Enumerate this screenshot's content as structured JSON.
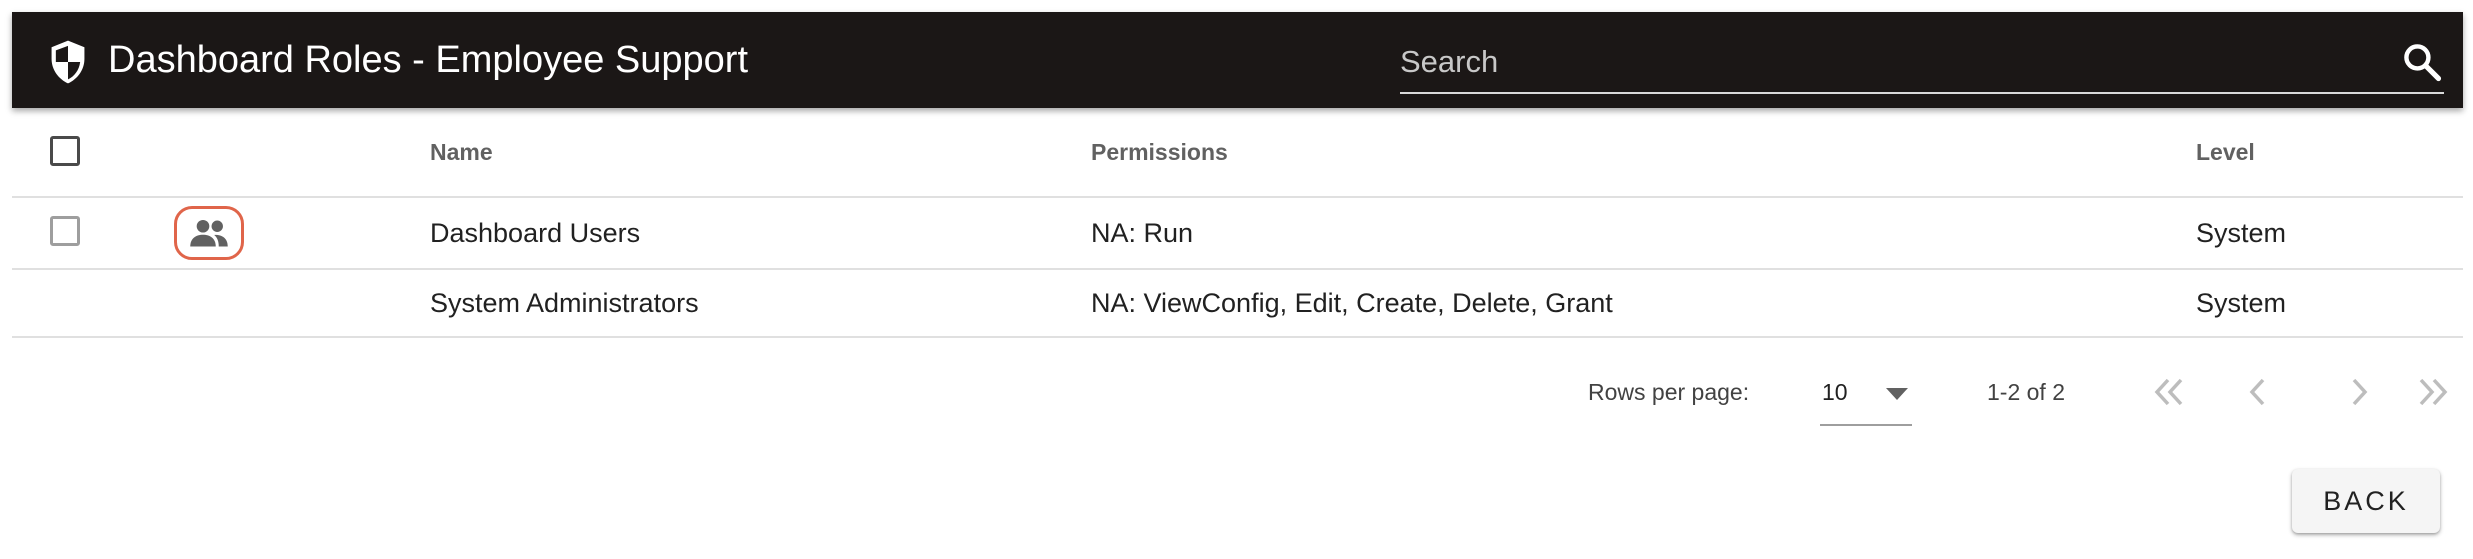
{
  "header": {
    "title": "Dashboard Roles - Employee Support",
    "icon": "shield-icon",
    "background": "#1b1716"
  },
  "search": {
    "placeholder": "Search",
    "value": ""
  },
  "table": {
    "columns": {
      "name": "Name",
      "permissions": "Permissions",
      "level": "Level"
    },
    "rows": [
      {
        "name": "Dashboard Users",
        "permissions": "NA: Run",
        "level": "System",
        "icon": "group-icon"
      },
      {
        "name": "System Administrators",
        "permissions": "NA: ViewConfig, Edit, Create, Delete, Grant",
        "level": "System"
      }
    ]
  },
  "pagination": {
    "rows_per_page_label": "Rows per page:",
    "rows_per_page_value": "10",
    "range": "1-2 of 2"
  },
  "actions": {
    "back_label": "BACK"
  },
  "colors": {
    "highlight": "#e0654a"
  }
}
